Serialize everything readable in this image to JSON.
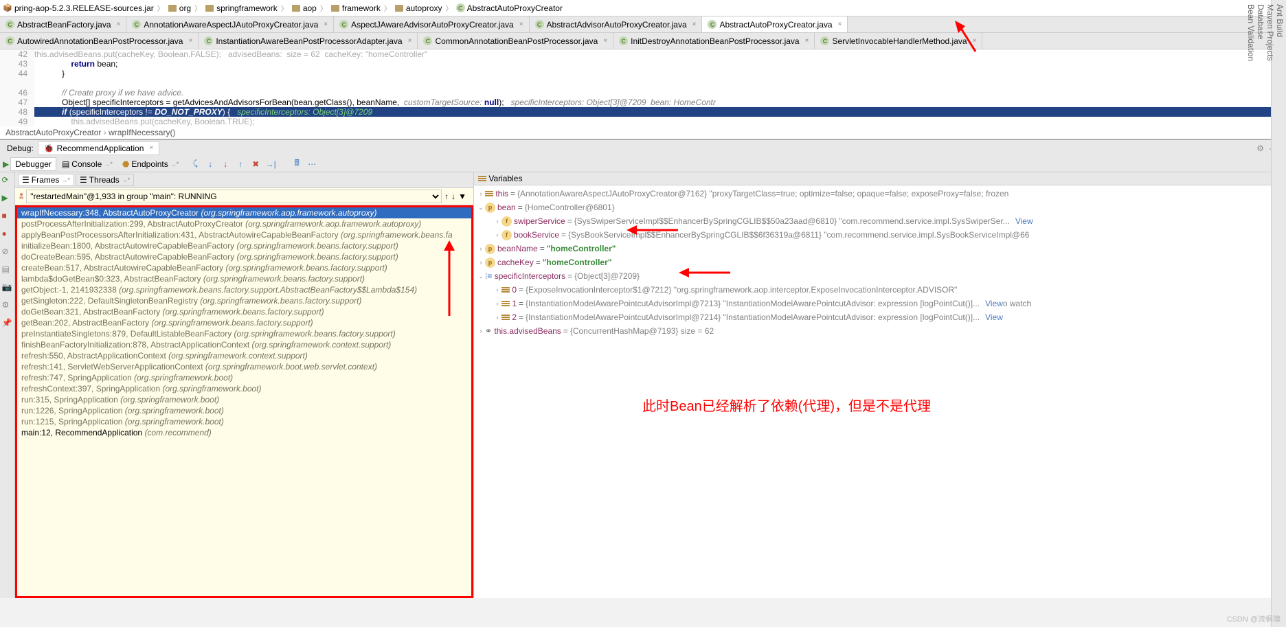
{
  "breadcrumbs": [
    {
      "label": "pring-aop-5.2.3.RELEASE-sources.jar",
      "icon": "jar"
    },
    {
      "label": "org",
      "icon": "folder"
    },
    {
      "label": "springframework",
      "icon": "folder"
    },
    {
      "label": "aop",
      "icon": "folder"
    },
    {
      "label": "framework",
      "icon": "folder"
    },
    {
      "label": "autoproxy",
      "icon": "folder"
    },
    {
      "label": "AbstractAutoProxyCreator",
      "icon": "class"
    }
  ],
  "tabs_row1": [
    {
      "label": "AbstractBeanFactory.java"
    },
    {
      "label": "AnnotationAwareAspectJAutoProxyCreator.java"
    },
    {
      "label": "AspectJAwareAdvisorAutoProxyCreator.java"
    },
    {
      "label": "AbstractAdvisorAutoProxyCreator.java"
    },
    {
      "label": "AbstractAutoProxyCreator.java",
      "active": true
    }
  ],
  "tabs_row2": [
    {
      "label": "AutowiredAnnotationBeanPostProcessor.java"
    },
    {
      "label": "InstantiationAwareBeanPostProcessorAdapter.java"
    },
    {
      "label": "CommonAnnotationBeanPostProcessor.java"
    },
    {
      "label": "InitDestroyAnnotationBeanPostProcessor.java"
    },
    {
      "label": "ServletInvocableHandlerMethod.java"
    }
  ],
  "code": {
    "l41": "this.advisedBeans.put(cacheKey, Boolean.FALSE);   advisedBeans:  size = 62  cacheKey: \"homeController\"",
    "l42_kw": "return",
    "l42_rest": " bean;",
    "l43": "}",
    "l45": "// Create proxy if we have advice.",
    "l46_a": "Object[] specificInterceptors = getAdvicesAndAdvisorsForBean(bean.getClass(), beanName,  ",
    "l46_b": "customTargetSource: ",
    "l46_c": "null",
    "l46_d": ");   ",
    "l46_e": "specificInterceptors: Object[3]@7209  bean: HomeContr",
    "l47_a": "if",
    "l47_b": " (specificInterceptors != ",
    "l47_c": "DO_NOT_PROXY",
    "l47_d": ") {   ",
    "l47_e": "specificInterceptors: Object[3]@7209",
    "l48_a": "this",
    "l48_b": ".advisedBeans.put(cacheKey, Boolean.",
    "l48_c": "TRUE",
    "l48_d": ");",
    "gutter": [
      "42",
      "43",
      "44",
      "",
      "46",
      "47",
      "48",
      "49"
    ]
  },
  "crumb2": {
    "a": "AbstractAutoProxyCreator",
    "b": "wrapIfNecessary()"
  },
  "debug": {
    "section": "Debug:",
    "runTab": "RecommendApplication",
    "subtabs": [
      "Debugger",
      "Console",
      "Endpoints"
    ],
    "frameTabs": [
      "Frames",
      "Threads"
    ],
    "varsHeader": "Variables",
    "thread": "\"restartedMain\"@1,933 in group \"main\": RUNNING"
  },
  "frames": [
    {
      "m": "wrapIfNecessary:348, AbstractAutoProxyCreator ",
      "loc": "(org.springframework.aop.framework.autoproxy)",
      "sel": true
    },
    {
      "m": "postProcessAfterInitialization:299, AbstractAutoProxyCreator ",
      "loc": "(org.springframework.aop.framework.autoproxy)"
    },
    {
      "m": "applyBeanPostProcessorsAfterInitialization:431, AbstractAutowireCapableBeanFactory ",
      "loc": "(org.springframework.beans.fa"
    },
    {
      "m": "initializeBean:1800, AbstractAutowireCapableBeanFactory ",
      "loc": "(org.springframework.beans.factory.support)"
    },
    {
      "m": "doCreateBean:595, AbstractAutowireCapableBeanFactory ",
      "loc": "(org.springframework.beans.factory.support)"
    },
    {
      "m": "createBean:517, AbstractAutowireCapableBeanFactory ",
      "loc": "(org.springframework.beans.factory.support)"
    },
    {
      "m": "lambda$doGetBean$0:323, AbstractBeanFactory ",
      "loc": "(org.springframework.beans.factory.support)"
    },
    {
      "m": "getObject:-1, 2141932338 ",
      "loc": "(org.springframework.beans.factory.support.AbstractBeanFactory$$Lambda$154)"
    },
    {
      "m": "getSingleton:222, DefaultSingletonBeanRegistry ",
      "loc": "(org.springframework.beans.factory.support)"
    },
    {
      "m": "doGetBean:321, AbstractBeanFactory ",
      "loc": "(org.springframework.beans.factory.support)"
    },
    {
      "m": "getBean:202, AbstractBeanFactory ",
      "loc": "(org.springframework.beans.factory.support)"
    },
    {
      "m": "preInstantiateSingletons:879, DefaultListableBeanFactory ",
      "loc": "(org.springframework.beans.factory.support)"
    },
    {
      "m": "finishBeanFactoryInitialization:878, AbstractApplicationContext ",
      "loc": "(org.springframework.context.support)"
    },
    {
      "m": "refresh:550, AbstractApplicationContext ",
      "loc": "(org.springframework.context.support)"
    },
    {
      "m": "refresh:141, ServletWebServerApplicationContext ",
      "loc": "(org.springframework.boot.web.servlet.context)"
    },
    {
      "m": "refresh:747, SpringApplication ",
      "loc": "(org.springframework.boot)"
    },
    {
      "m": "refreshContext:397, SpringApplication ",
      "loc": "(org.springframework.boot)"
    },
    {
      "m": "run:315, SpringApplication ",
      "loc": "(org.springframework.boot)"
    },
    {
      "m": "run:1226, SpringApplication ",
      "loc": "(org.springframework.boot)"
    },
    {
      "m": "run:1215, SpringApplication ",
      "loc": "(org.springframework.boot)"
    },
    {
      "m": "main:12, RecommendApplication ",
      "loc": "(com.recommend)",
      "last": true
    }
  ],
  "vars": {
    "this": {
      "name": "this",
      "val": "{AnnotationAwareAspectJAutoProxyCreator@7162} \"proxyTargetClass=true; optimize=false; opaque=false; exposeProxy=false; frozen"
    },
    "bean": {
      "name": "bean",
      "val": "{HomeController@6801}"
    },
    "swiper": {
      "name": "swiperService",
      "val": "{SysSwiperServiceImpl$$EnhancerBySpringCGLIB$$50a23aad@6810} \"com.recommend.service.impl.SysSwiperSer...",
      "view": "View"
    },
    "book": {
      "name": "bookService",
      "val": "{SysBookServiceImpl$$EnhancerBySpringCGLIB$$6f36319a@6811} \"com.recommend.service.impl.SysBookServiceImpl@66"
    },
    "beanName": {
      "name": "beanName",
      "val": "\"homeController\""
    },
    "cacheKey": {
      "name": "cacheKey",
      "val": "\"homeController\""
    },
    "spec": {
      "name": "specificInterceptors",
      "val": "{Object[3]@7209}"
    },
    "s0": {
      "name": "0",
      "val": "{ExposeInvocationInterceptor$1@7212} \"org.springframework.aop.interceptor.ExposeInvocationInterceptor.ADVISOR\""
    },
    "s1": {
      "name": "1",
      "val": "{InstantiationModelAwarePointcutAdvisorImpl@7213} \"InstantiationModelAwarePointcutAdvisor: expression [logPointCut()]...",
      "view": "View",
      "extra": "o watch"
    },
    "s2": {
      "name": "2",
      "val": "{InstantiationModelAwarePointcutAdvisorImpl@7214} \"InstantiationModelAwarePointcutAdvisor: expression [logPointCut()]...",
      "view": "View"
    },
    "advised": {
      "name": "this.advisedBeans",
      "val": "{ConcurrentHashMap@7193}  size = 62"
    }
  },
  "rightStrip": [
    "Ant Build",
    "Maven Projects",
    "Database",
    "Bean Validation"
  ],
  "annotation": "此时Bean已经解析了依赖(代理)，但是不是代理",
  "watermark": "CSDN @流枫噢"
}
